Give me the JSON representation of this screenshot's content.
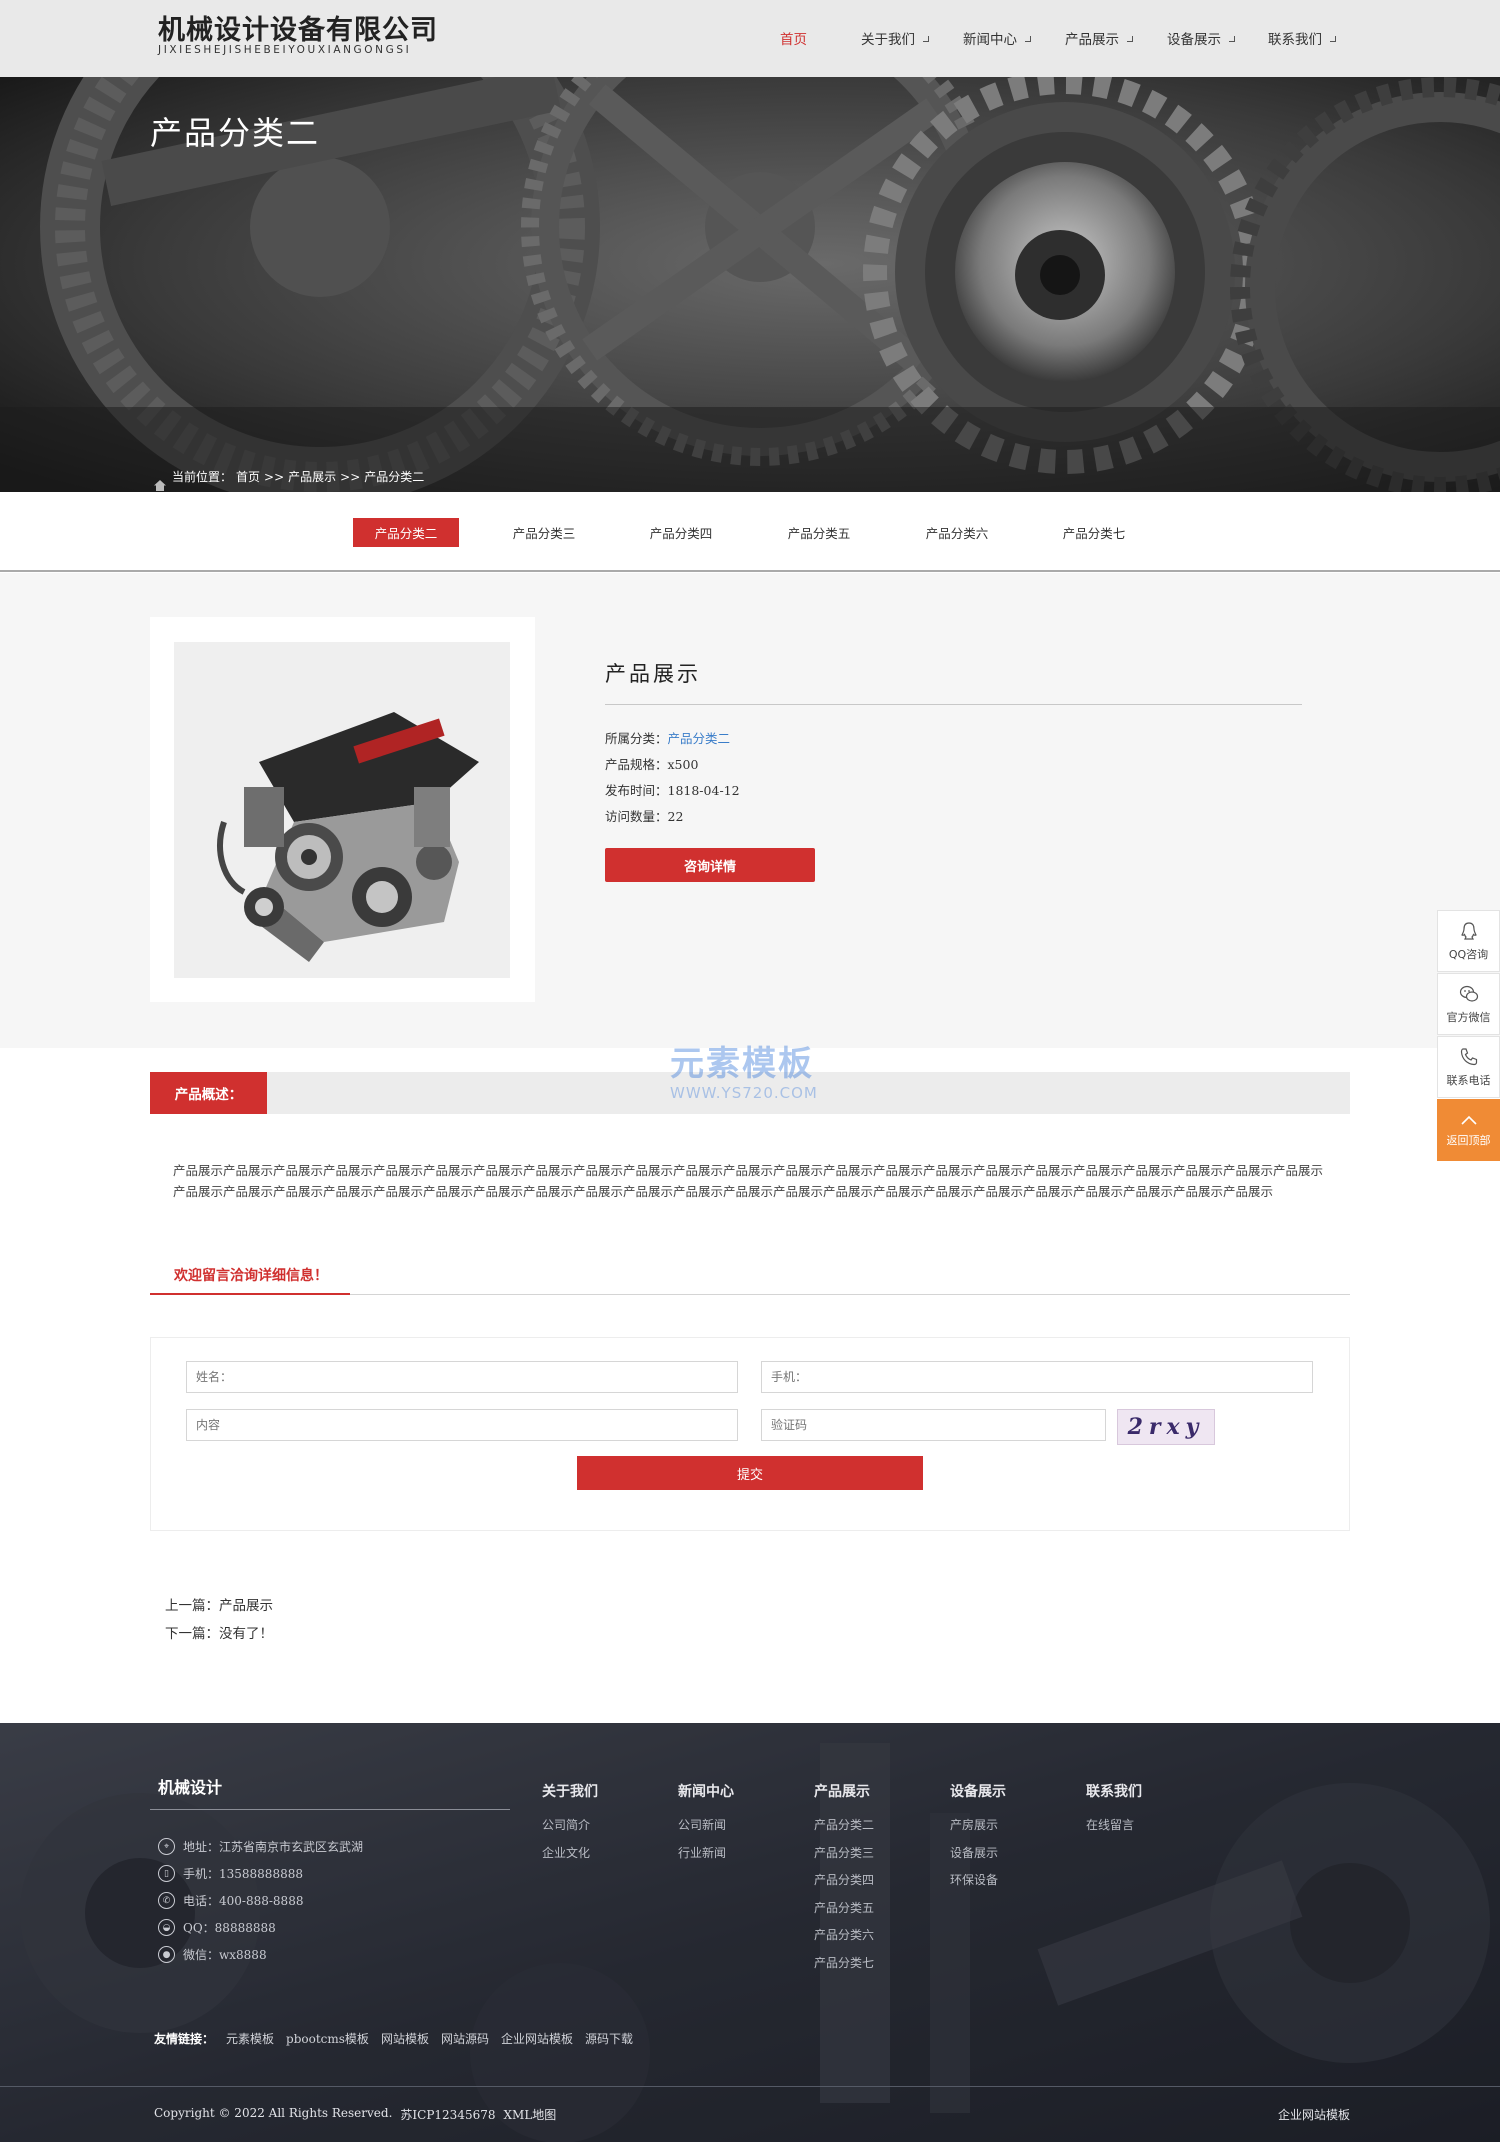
{
  "header": {
    "logo_cn": "机械设计设备有限公司",
    "logo_en": "JIXIESHEJISHEBEIYOUXIANGONGSI",
    "nav": [
      "首页",
      "关于我们",
      "新闻中心",
      "产品展示",
      "设备展示",
      "联系我们"
    ]
  },
  "banner": {
    "title": "产品分类二",
    "breadcrumb": {
      "prefix": "当前位置：",
      "home": "首页",
      "sep": ">>",
      "level1": "产品展示",
      "level2": "产品分类二"
    }
  },
  "tabs": [
    "产品分类二",
    "产品分类三",
    "产品分类四",
    "产品分类五",
    "产品分类六",
    "产品分类七"
  ],
  "product": {
    "heading": "产品展示",
    "category_label": "所属分类：",
    "category_value": "产品分类二",
    "spec": "产品规格：x500",
    "date": "发布时间：1818-04-12",
    "visits": "访问数量：22",
    "consult_button": "咨询详情"
  },
  "watermark": {
    "cn": "元素模板",
    "en": "WWW.YS720.COM"
  },
  "overview": {
    "label": "产品概述：",
    "text": "产品展示产品展示产品展示产品展示产品展示产品展示产品展示产品展示产品展示产品展示产品展示产品展示产品展示产品展示产品展示产品展示产品展示产品展示产品展示产品展示产品展示产品展示产品展示产品展示产品展示产品展示产品展示产品展示产品展示产品展示产品展示产品展示产品展示产品展示产品展示产品展示产品展示产品展示产品展示产品展示产品展示产品展示产品展示产品展示产品展示"
  },
  "message": {
    "title": "欢迎留言洽询详细信息！",
    "name_placeholder": "姓名：",
    "phone_placeholder": "手机：",
    "content_placeholder": "内容",
    "captcha_placeholder": "验证码",
    "captcha_text": "2rxy",
    "submit": "提交"
  },
  "pager": {
    "prev": "上一篇：产品展示",
    "next": "下一篇：没有了！"
  },
  "footer": {
    "brand": "机械设计",
    "contact": [
      {
        "icon": "location-icon",
        "glyph": "⌖",
        "text": "地址：江苏省南京市玄武区玄武湖"
      },
      {
        "icon": "mobile-icon",
        "glyph": "▯",
        "text": "手机：13588888888"
      },
      {
        "icon": "phone-icon",
        "glyph": "✆",
        "text": "电话：400-888-8888"
      },
      {
        "icon": "qq-icon",
        "glyph": "◒",
        "text": "QQ：88888888"
      },
      {
        "icon": "wechat-icon",
        "glyph": "●",
        "text": "微信：wx8888"
      }
    ],
    "columns": [
      {
        "title": "关于我们",
        "links": [
          "公司简介",
          "企业文化"
        ]
      },
      {
        "title": "新闻中心",
        "links": [
          "公司新闻",
          "行业新闻"
        ]
      },
      {
        "title": "产品展示",
        "links": [
          "产品分类二",
          "产品分类三",
          "产品分类四",
          "产品分类五",
          "产品分类六",
          "产品分类七"
        ]
      },
      {
        "title": "设备展示",
        "links": [
          "产房展示",
          "设备展示",
          "环保设备"
        ]
      },
      {
        "title": "联系我们",
        "links": [
          "在线留言"
        ]
      }
    ],
    "friends_label": "友情链接：",
    "friends": [
      "元素模板",
      "pbootcms模板",
      "网站模板",
      "网站源码",
      "企业网站模板",
      "源码下载"
    ],
    "copyright": "Copyright © 2022 All Rights Reserved.",
    "icp": "苏ICP12345678",
    "sitemap": "XML地图",
    "right_link": "企业网站模板"
  },
  "side": {
    "qq": "QQ咨询",
    "wechat": "官方微信",
    "phone": "联系电话",
    "top": "返回顶部"
  },
  "colors": {
    "accent": "#d0302f",
    "link": "#3a7dc9",
    "side_top": "#f08b35"
  }
}
